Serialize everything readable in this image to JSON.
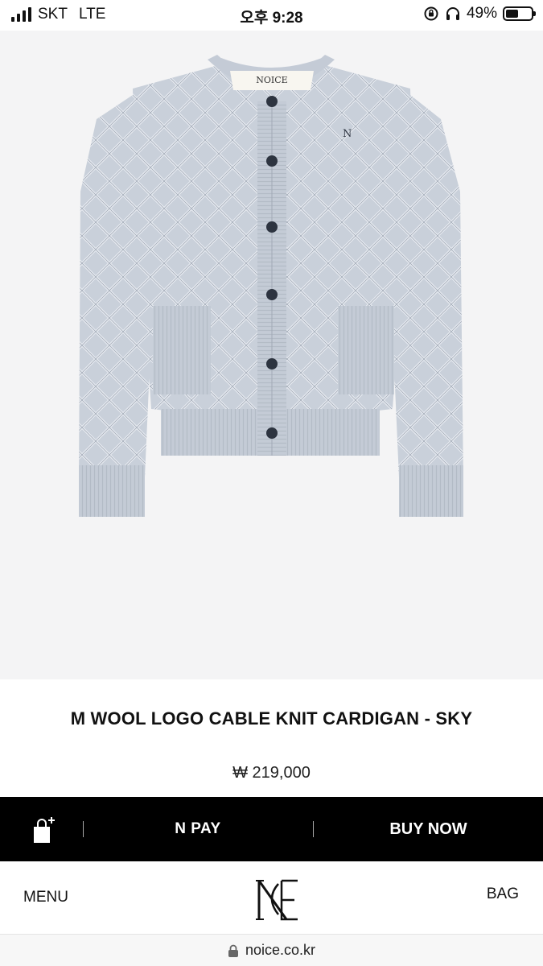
{
  "status_bar": {
    "carrier": "SKT",
    "network": "LTE",
    "time": "오후 9:28",
    "battery_text": "49%",
    "battery_level": 0.49
  },
  "product": {
    "image_alt_label": "NOICE",
    "title": "M WOOL LOGO CABLE KNIT CARDIGAN - SKY",
    "price": "₩ 219,000",
    "garment_color": "#c9d0da",
    "background_color": "#f4f4f5"
  },
  "actions": {
    "cart_icon": "shopping-bag-plus-icon",
    "npay_label": "N PAY",
    "buy_now_label": "BUY NOW"
  },
  "nav": {
    "menu_label": "MENU",
    "bag_label": "BAG",
    "logo_icon": "noice-logo"
  },
  "browser": {
    "url": "noice.co.kr",
    "lock_icon": "lock-icon"
  }
}
